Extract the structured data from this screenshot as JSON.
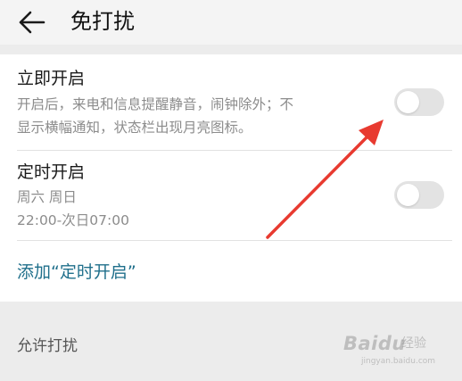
{
  "header": {
    "title": "免打扰"
  },
  "settings": {
    "immediate": {
      "title": "立即开启",
      "desc_line1": "开启后，来电和信息提醒静音，闹钟除外；不",
      "desc_line2": "显示横幅通知，状态栏出现月亮图标。",
      "enabled": false
    },
    "scheduled": {
      "title": "定时开启",
      "days": "周六 周日",
      "time": "22:00-次日07:00",
      "enabled": false
    },
    "add_schedule_label": "添加“定时开启”"
  },
  "section": {
    "allow_interruptions_label": "允许打扰"
  },
  "watermark": {
    "brand": "Baidu",
    "experience": "经验",
    "domain": "jingyan.baidu.com"
  },
  "colors": {
    "link": "#1f6f8b",
    "arrow": "#e83a30",
    "toggle_off": "#e3e3e3"
  },
  "icons": {
    "back": "back-arrow-icon"
  }
}
